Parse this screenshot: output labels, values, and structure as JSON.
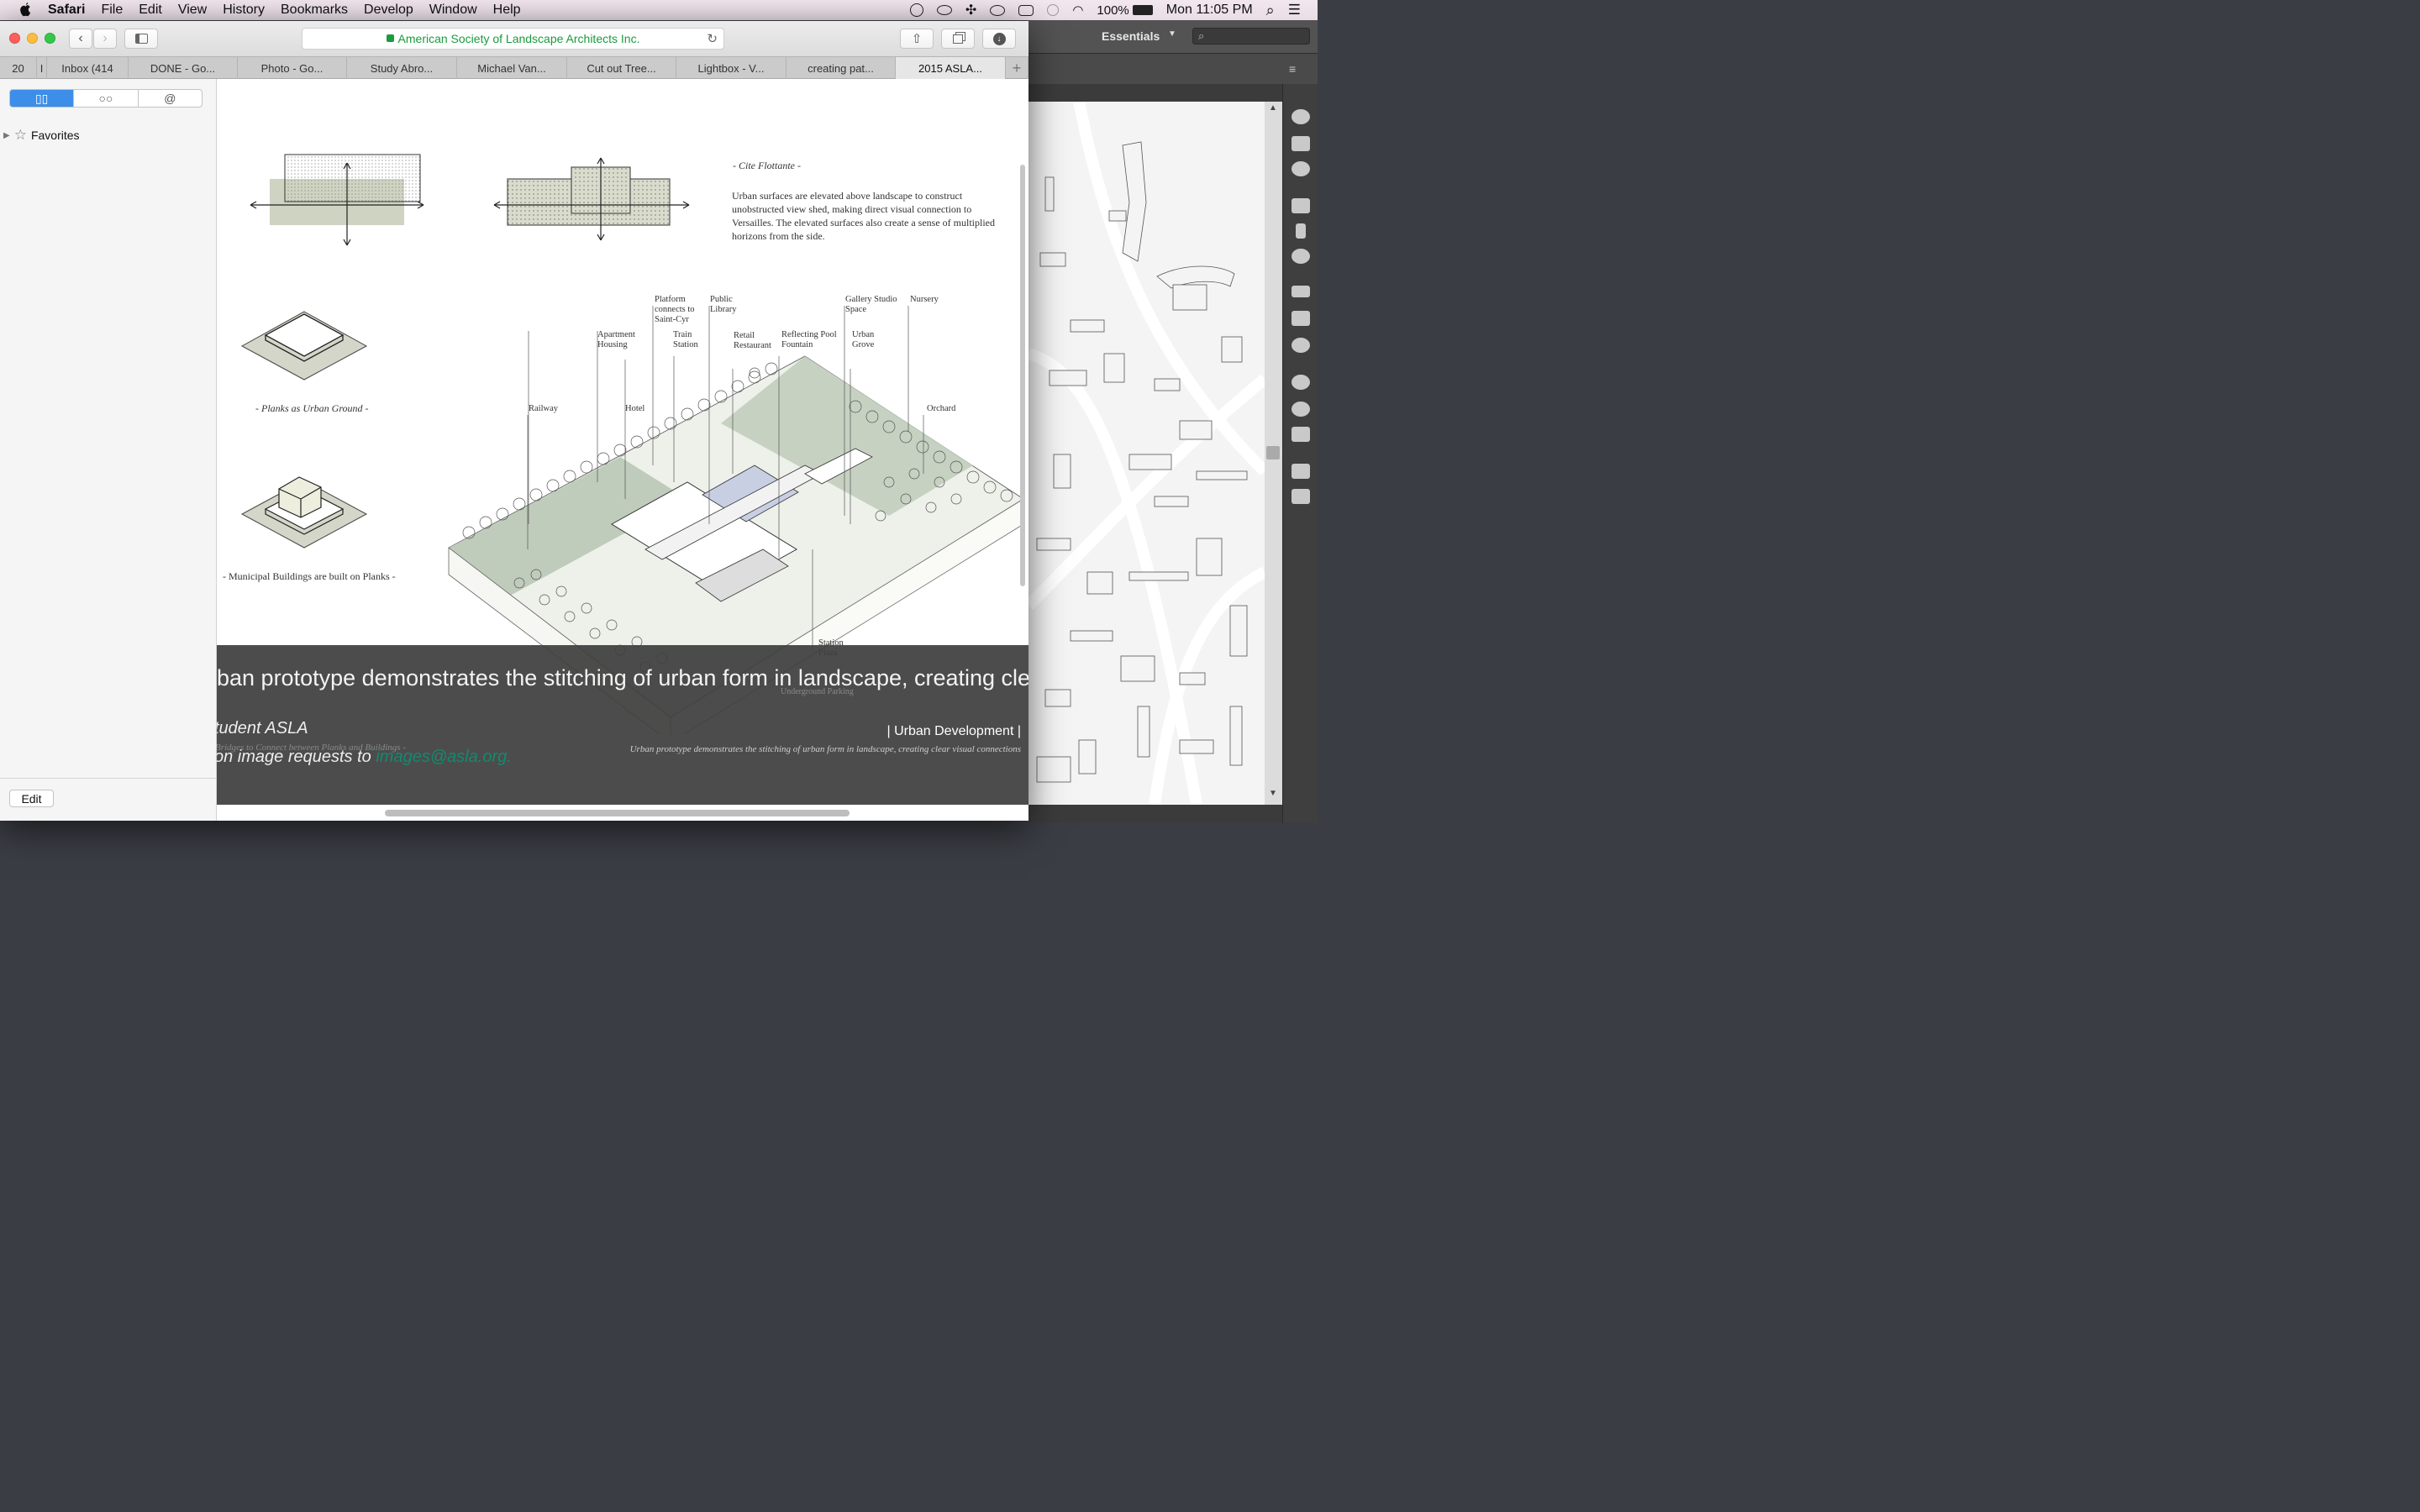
{
  "menubar": {
    "app": "Safari",
    "menus": [
      "File",
      "Edit",
      "View",
      "History",
      "Bookmarks",
      "Develop",
      "Window",
      "Help"
    ],
    "battery": "100%",
    "clock": "Mon 11:05 PM"
  },
  "browser": {
    "address": "American Society of Landscape Architects Inc.",
    "tabs": [
      "20",
      "I",
      "Inbox (414",
      "DONE - Go...",
      "Photo - Go...",
      "Study Abro...",
      "Michael Van...",
      "Cut out Tree...",
      "Lightbox - V...",
      "creating pat...",
      "2015 ASLA..."
    ],
    "active_tab_index": 10
  },
  "sidebar": {
    "favorites_label": "Favorites",
    "edit_label": "Edit",
    "segments": [
      "bookmarks",
      "reading-list",
      "shared-links"
    ]
  },
  "photoshop": {
    "workspace": "Essentials"
  },
  "figure": {
    "cite_title": "- Cite Flottante -",
    "cite_text": "Urban surfaces are elevated above landscape to construct unobstructed view shed, making direct visual connection to Versailles. The elevated surfaces also create a sense of multiplied horizons from the side.",
    "planks_label": "- Planks as Urban Ground -",
    "municipal_label": "- Municipal Buildings are built on Planks -",
    "labels": {
      "platform": "Platform connects to Saint-Cyr",
      "library": "Public Library",
      "gallery": "Gallery Studio Space",
      "nursery": "Nursery",
      "apartment": "Apartment Housing",
      "train": "Train Station",
      "retail": "Retail Restaurant",
      "pool": "Reflecting Pool Fountain",
      "grove": "Urban Grove",
      "railway": "Railway",
      "hotel": "Hotel",
      "orchard": "Orchard",
      "station_plaza": "Station Plaza",
      "underground": "Underground Parking",
      "bridges": "Bridges to Connect between Planks and Buildings -"
    }
  },
  "caption": {
    "main": "ban prototype demonstrates the stitching of urban form in landscape, creating cle",
    "name": "tudent ASLA",
    "request_prefix": "on image requests to ",
    "email": "images@asla.org.",
    "category": "| Urban Development |",
    "sub": "Urban prototype demonstrates the stitching of urban form in landscape, creating clear visual connections"
  }
}
